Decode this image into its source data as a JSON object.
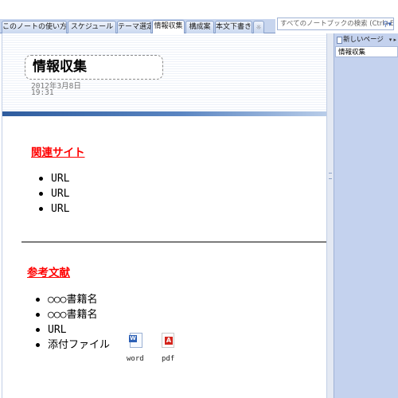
{
  "tabs": [
    {
      "label": "このノートの使い方",
      "active": false
    },
    {
      "label": "スケジュール",
      "active": false
    },
    {
      "label": "テーマ選定",
      "active": false
    },
    {
      "label": "情報収集",
      "active": true
    },
    {
      "label": "構成案",
      "active": false
    },
    {
      "label": "本文下書き",
      "active": false
    },
    {
      "label": "☼",
      "active": false
    }
  ],
  "search": {
    "placeholder": "すべてのノートブックの検索 (Ctrl+E)"
  },
  "page": {
    "title": "情報収集",
    "date": "2012年3月8日",
    "time": "19:31"
  },
  "section1": {
    "heading": "関連サイト",
    "items": [
      "URL",
      "URL",
      "URL"
    ]
  },
  "section2": {
    "heading": "参考文献",
    "items": [
      "○○○書籍名",
      "○○○書籍名",
      "URL",
      "添付ファイル"
    ],
    "attachments": [
      {
        "label": "word",
        "icon": "word-file-icon"
      },
      {
        "label": "pdf",
        "icon": "pdf-file-icon"
      }
    ]
  },
  "sidebar": {
    "new_page_label": "新しいページ",
    "pages": [
      "情報収集"
    ]
  },
  "colors": {
    "heading": "#ff0000",
    "accent": "#2e5c9e",
    "sidebar": "#c4d2ee"
  }
}
